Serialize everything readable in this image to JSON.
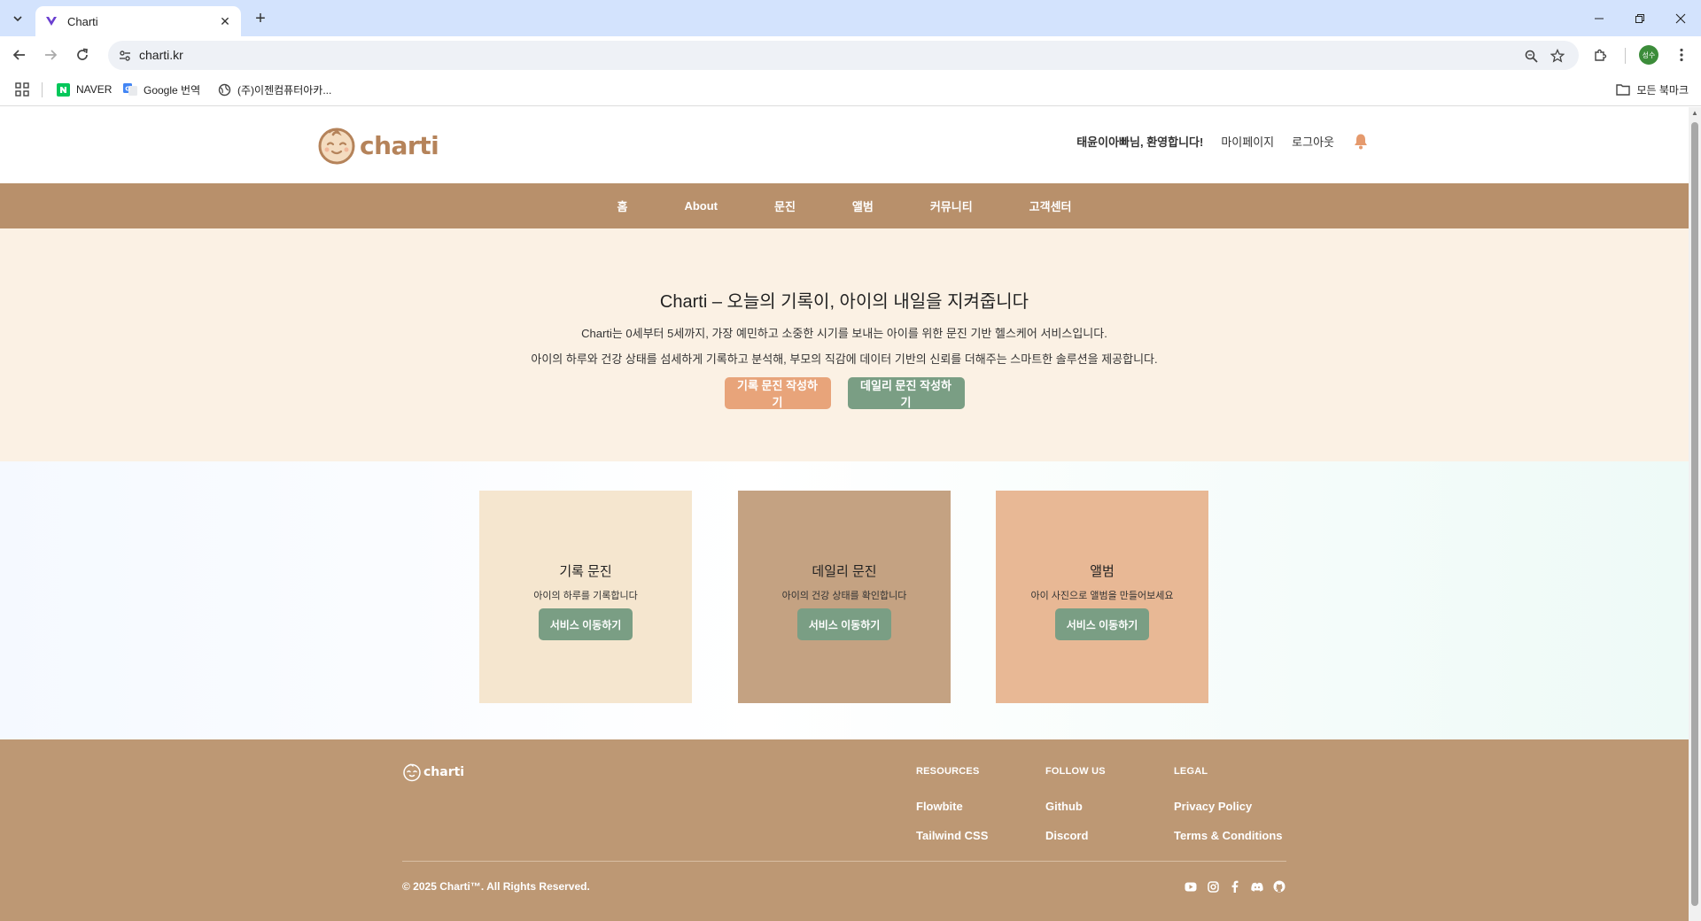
{
  "browser": {
    "tab_title": "Charti",
    "url": "charti.kr",
    "profile_initials": "성수",
    "bookmarks": [
      {
        "label": "NAVER"
      },
      {
        "label": "Google 번역"
      },
      {
        "label": "(주)이젠컴퓨터아카..."
      }
    ],
    "all_bookmarks_label": "모든 북마크"
  },
  "header": {
    "logo_text": "charti",
    "welcome": "태윤이아빠님, 환영합니다!",
    "mypage": "마이페이지",
    "logout": "로그아웃"
  },
  "nav": {
    "items": [
      "홈",
      "About",
      "문진",
      "앨범",
      "커뮤니티",
      "고객센터"
    ]
  },
  "hero": {
    "title": "Charti – 오늘의 기록이, 아이의 내일을 지켜줍니다",
    "desc1": "Charti는 0세부터 5세까지, 가장 예민하고 소중한 시기를 보내는 아이를 위한 문진 기반 헬스케어 서비스입니다.",
    "desc2": "아이의 하루와 건강 상태를 섬세하게 기록하고 분석해, 부모의 직감에 데이터 기반의 신뢰를 더해주는 스마트한 솔루션을 제공합니다.",
    "btn_record": "기록 문진 작성하기",
    "btn_daily": "데일리 문진 작성하기"
  },
  "cards": [
    {
      "title": "기록 문진",
      "desc": "아이의 하루를 기록합니다",
      "button": "서비스 이동하기"
    },
    {
      "title": "데일리 문진",
      "desc": "아이의 건강 상태를 확인합니다",
      "button": "서비스 이동하기"
    },
    {
      "title": "앨범",
      "desc": "아이 사진으로 앨범을 만들어보세요",
      "button": "서비스 이동하기"
    }
  ],
  "footer": {
    "logo_text": "charti",
    "resources": {
      "title": "RESOURCES",
      "links": [
        "Flowbite",
        "Tailwind CSS"
      ]
    },
    "follow": {
      "title": "FOLLOW US",
      "links": [
        "Github",
        "Discord"
      ]
    },
    "legal": {
      "title": "LEGAL",
      "links": [
        "Privacy Policy",
        "Terms & Conditions"
      ]
    },
    "copyright": "© 2025 Charti™. All Rights Reserved.",
    "social_icons": [
      "youtube-icon",
      "instagram-icon",
      "facebook-icon",
      "discord-icon",
      "github-icon"
    ]
  },
  "colors": {
    "brand_brown": "#b8906b",
    "hero_bg": "#fbf1e4",
    "btn_orange": "#e8a47a",
    "btn_green": "#7a9e84",
    "card1": "#f5e6cf",
    "card2": "#c4a282",
    "card3": "#e8b895",
    "footer_bg": "#bd9874"
  }
}
